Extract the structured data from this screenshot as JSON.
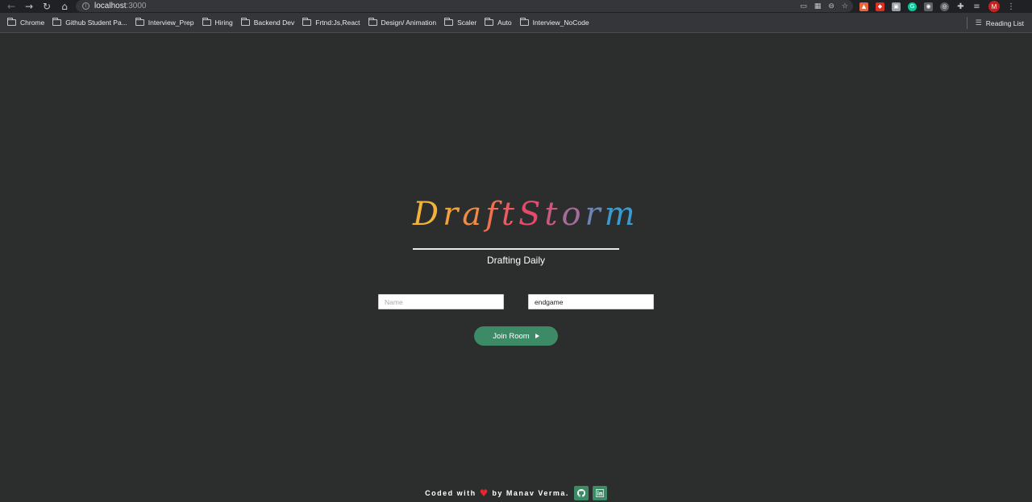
{
  "browser": {
    "url_host": "localhost",
    "url_port": ":3000",
    "avatar_initial": "M",
    "bookmarks": [
      "Chrome",
      "Github Student Pa...",
      "Interview_Prep",
      "Hiring",
      "Backend Dev",
      "Frtnd:Js,React",
      "Design/ Animation",
      "Scaler",
      "Auto",
      "Interview_NoCode"
    ],
    "reading_list": "Reading List"
  },
  "app": {
    "logo_letters": [
      {
        "ch": "D",
        "color": "#f3b33a"
      },
      {
        "ch": "r",
        "color": "#f2a23c"
      },
      {
        "ch": "a",
        "color": "#f08a44"
      },
      {
        "ch": "f",
        "color": "#ef7150"
      },
      {
        "ch": "t",
        "color": "#ec5b5e"
      },
      {
        "ch": "S",
        "color": "#e54a6a"
      },
      {
        "ch": "t",
        "color": "#c95a7e"
      },
      {
        "ch": "o",
        "color": "#a36c99"
      },
      {
        "ch": "r",
        "color": "#6c85b6"
      },
      {
        "ch": "m",
        "color": "#3a9bd1"
      }
    ],
    "tagline": "Drafting Daily",
    "name_placeholder": "Name",
    "room_value": "endgame",
    "join_label": "Join Room"
  },
  "footer": {
    "prefix": "Coded with",
    "suffix": "by Manav Verma."
  },
  "colors": {
    "background": "#2c2e2d",
    "accent": "#3d8a67",
    "heart": "#e8262d"
  }
}
